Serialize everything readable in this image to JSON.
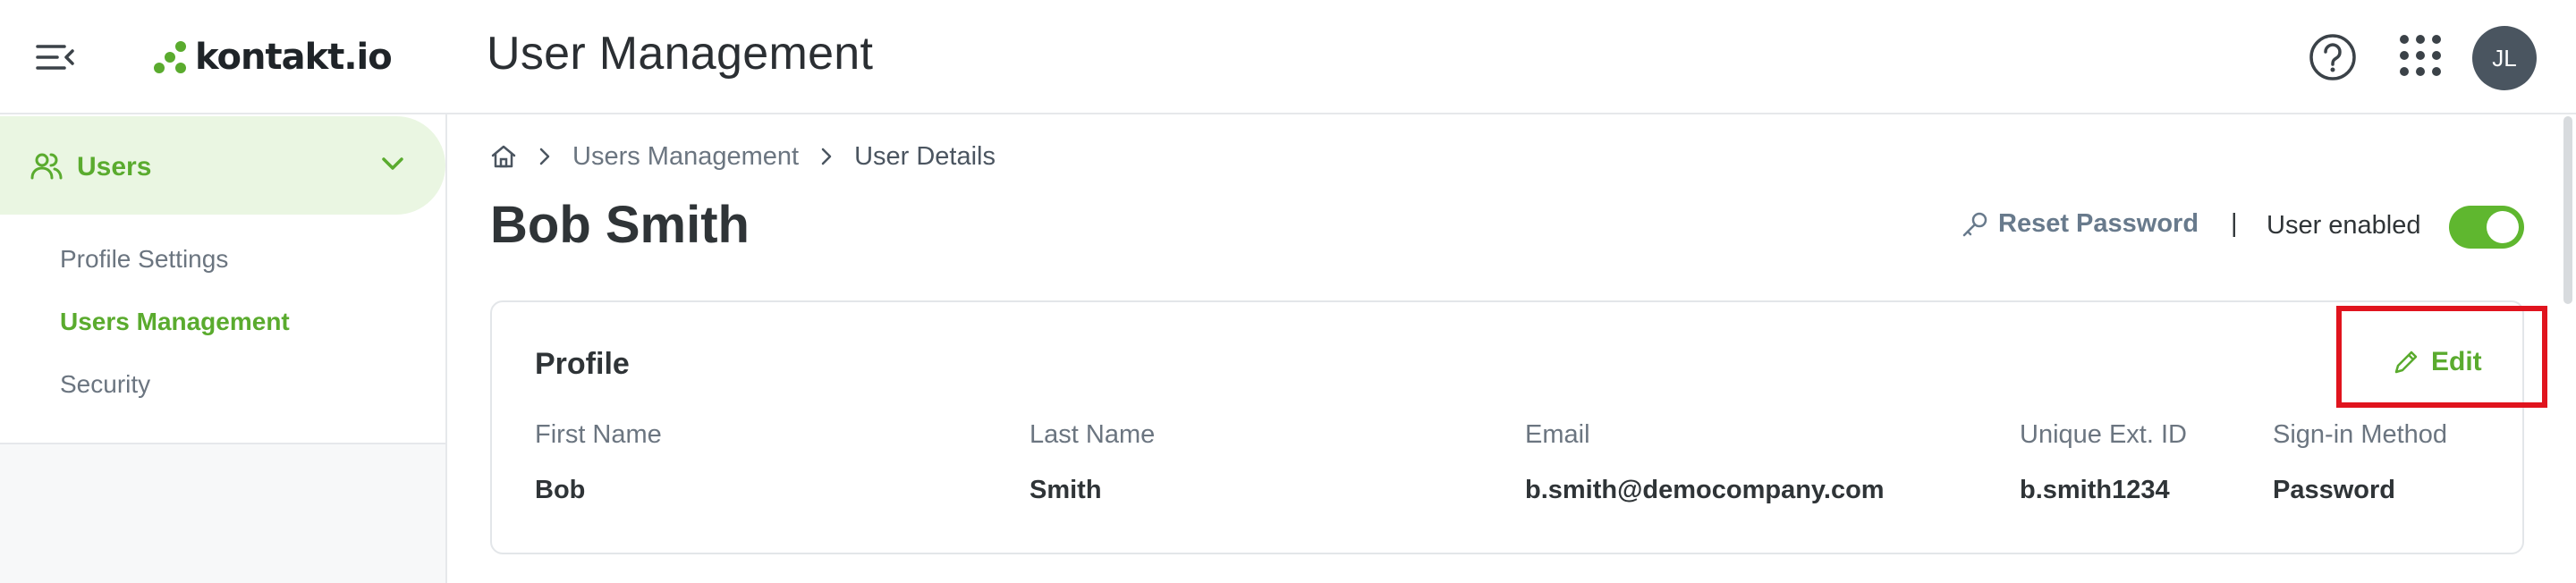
{
  "header": {
    "logo_text": "kontakt.io",
    "app_title": "User Management",
    "avatar_initials": "JL"
  },
  "sidebar": {
    "group_label": "Users",
    "items": [
      {
        "label": "Profile Settings",
        "active": false
      },
      {
        "label": "Users Management",
        "active": true
      },
      {
        "label": "Security",
        "active": false
      }
    ]
  },
  "breadcrumb": {
    "items": [
      "Users Management",
      "User Details"
    ]
  },
  "page": {
    "title": "Bob Smith",
    "reset_password_label": "Reset Password",
    "separator": "|",
    "user_enabled_label": "User enabled",
    "user_enabled": true
  },
  "profile": {
    "title": "Profile",
    "edit_label": "Edit",
    "fields": [
      {
        "label": "First Name",
        "value": "Bob"
      },
      {
        "label": "Last Name",
        "value": "Smith"
      },
      {
        "label": "Email",
        "value": "b.smith@democompany.com"
      },
      {
        "label": "Unique Ext. ID",
        "value": "b.smith1234"
      },
      {
        "label": "Sign-in Method",
        "value": "Password"
      }
    ]
  },
  "colors": {
    "accent_green": "#5aab2e",
    "toggle_green": "#5fb72f",
    "highlight_red": "#e0141e",
    "sidebar_active_bg": "#eaf6e2"
  },
  "icons": {
    "menu": "menu-collapse-icon",
    "logo": "kontakt-logo-mark",
    "help": "help-circle-icon",
    "apps": "apps-grid-icon",
    "users": "users-icon",
    "chevron": "chevron-down-icon",
    "home": "home-icon",
    "breadcrumb_sep": "chevron-right-icon",
    "key": "key-icon",
    "edit": "pencil-icon"
  }
}
